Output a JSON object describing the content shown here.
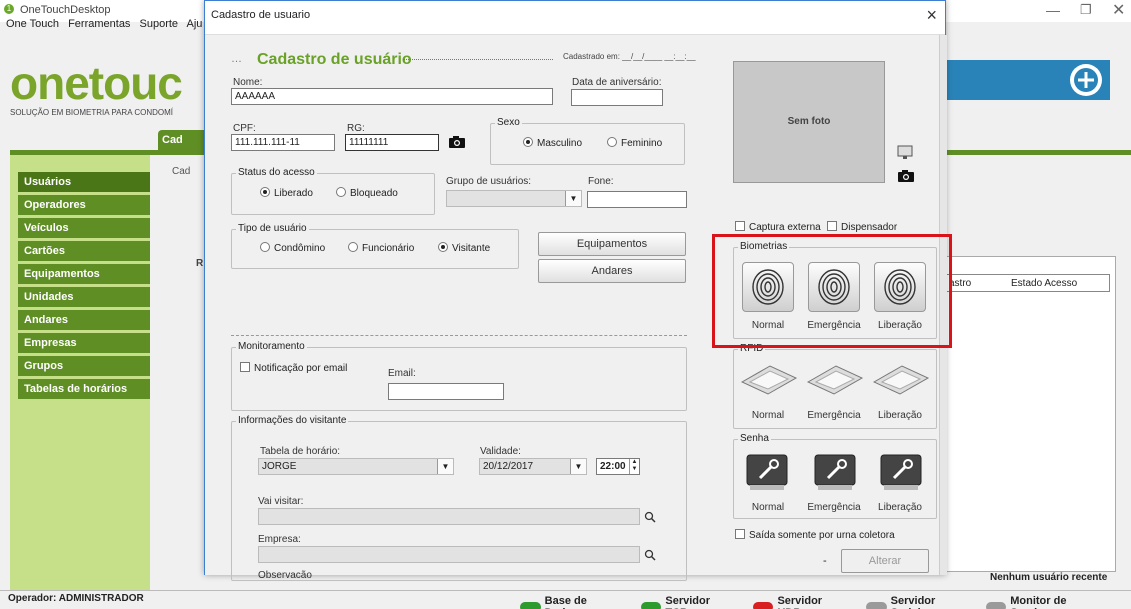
{
  "window": {
    "title": "OneTouchDesktop"
  },
  "menu": [
    "One Touch",
    "Ferramentas",
    "Suporte",
    "Aju"
  ],
  "brand": {
    "logo": "onetouc",
    "tagline": "SOLUÇÃO EM BIOMETRIA PARA CONDOMÍ"
  },
  "tab": {
    "label": "Cad"
  },
  "sidebar": [
    {
      "label": "Usuários"
    },
    {
      "label": "Operadores"
    },
    {
      "label": "Veículos"
    },
    {
      "label": "Cartões"
    },
    {
      "label": "Equipamentos"
    },
    {
      "label": "Unidades"
    },
    {
      "label": "Andares"
    },
    {
      "label": "Empresas"
    },
    {
      "label": "Grupos"
    },
    {
      "label": "Tabelas de horários"
    }
  ],
  "behind": {
    "cad_label": "Cad",
    "r_label": "R",
    "col_cadastro": "astro",
    "col_estado": "Estado Acesso",
    "no_recent": "Nenhum usuário recente"
  },
  "status": {
    "operator": "Operador: ADMINISTRADOR",
    "items": [
      {
        "label": "Base de Dados",
        "color": "#2e9b2e"
      },
      {
        "label": "Servidor TCP",
        "color": "#2e9b2e"
      },
      {
        "label": "Servidor UDP",
        "color": "#d82020"
      },
      {
        "label": "Servidor Serial",
        "color": "#9a9a9a"
      },
      {
        "label": "Monitor de Servicos",
        "color": "#9a9a9a"
      }
    ]
  },
  "dialog": {
    "title": "Cadastro de usuario",
    "close": "×",
    "heading": "Cadastro de usuário",
    "cadastrado": "Cadastrado em: __/__/____ __:__:__",
    "nome_label": "Nome:",
    "nome_value": "AAAAAA",
    "aniversario_label": "Data de aniversário:",
    "cpf_label": "CPF:",
    "cpf_value": "111.111.111-11",
    "rg_label": "RG:",
    "rg_value": "11111111",
    "sexo_label": "Sexo",
    "sexo_options": [
      "Masculino",
      "Feminino"
    ],
    "status_label": "Status do acesso",
    "status_options": [
      "Liberado",
      "Bloqueado"
    ],
    "grupo_label": "Grupo de usuários:",
    "fone_label": "Fone:",
    "tipo_label": "Tipo de usuário",
    "tipo_options": [
      "Condômino",
      "Funcionário",
      "Visitante"
    ],
    "equipamentos_btn": "Equipamentos",
    "andares_btn": "Andares",
    "monitor_label": "Monitoramento",
    "notif_label": "Notificação por email",
    "email_label": "Email:",
    "info_label": "Informações do visitante",
    "tabela_label": "Tabela de horário:",
    "tabela_value": "JORGE",
    "validade_label": "Validade:",
    "validade_value": "20/12/2017",
    "hora_value": "22:00",
    "vai_visitar_label": "Vai visitar:",
    "empresa_label": "Empresa:",
    "observacao_label": "Observação",
    "sem_foto": "Sem foto",
    "captura_label": "Captura externa",
    "dispensador_label": "Dispensador",
    "biometrias_label": "Biometrias",
    "rfid_label": "RFID",
    "senha_label": "Senha",
    "cap_normal": "Normal",
    "cap_emergencia": "Emergência",
    "cap_liberacao": "Liberação",
    "saida_label": "Saída somente por urna coletora",
    "dash": "-",
    "alterar_btn": "Alterar"
  }
}
